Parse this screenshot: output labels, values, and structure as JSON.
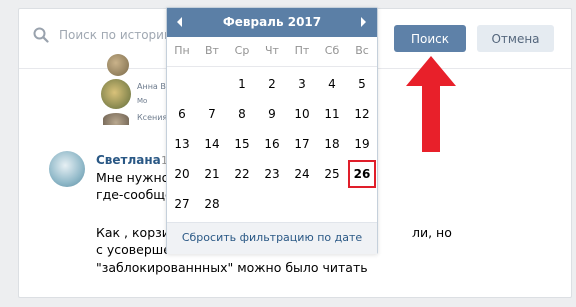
{
  "search": {
    "placeholder": "Поиск по истории",
    "search_button": "Поиск",
    "cancel_button": "Отмена"
  },
  "mini_list": [
    {
      "name": "Анна Ваш"
    },
    {
      "name": "Мо"
    },
    {
      "name": "Ксения"
    }
  ],
  "post": {
    "author": "Светлана",
    "time": "1",
    "lines": [
      "Мне нужно",
      "где-сообще",
      "Как , корзин",
      "с усовершен",
      "\"заблокированнных\" можно было читать"
    ],
    "trailing_fragment": "ли, но"
  },
  "calendar": {
    "title": "Февраль 2017",
    "weekdays": [
      "Пн",
      "Вт",
      "Ср",
      "Чт",
      "Пт",
      "Сб",
      "Вс"
    ],
    "weeks": [
      [
        "",
        "",
        "1",
        "2",
        "3",
        "4",
        "5"
      ],
      [
        "6",
        "7",
        "8",
        "9",
        "10",
        "11",
        "12"
      ],
      [
        "13",
        "14",
        "15",
        "16",
        "17",
        "18",
        "19"
      ],
      [
        "20",
        "21",
        "22",
        "23",
        "24",
        "25",
        "26"
      ],
      [
        "27",
        "28",
        "",
        "",
        "",
        "",
        ""
      ]
    ],
    "highlighted_day": "26",
    "reset_label": "Сбросить фильтрацию по дате"
  },
  "colors": {
    "accent": "#5b7fa6",
    "link": "#2a5885",
    "highlight": "#e01e2a",
    "arrow": "#e8202a"
  }
}
